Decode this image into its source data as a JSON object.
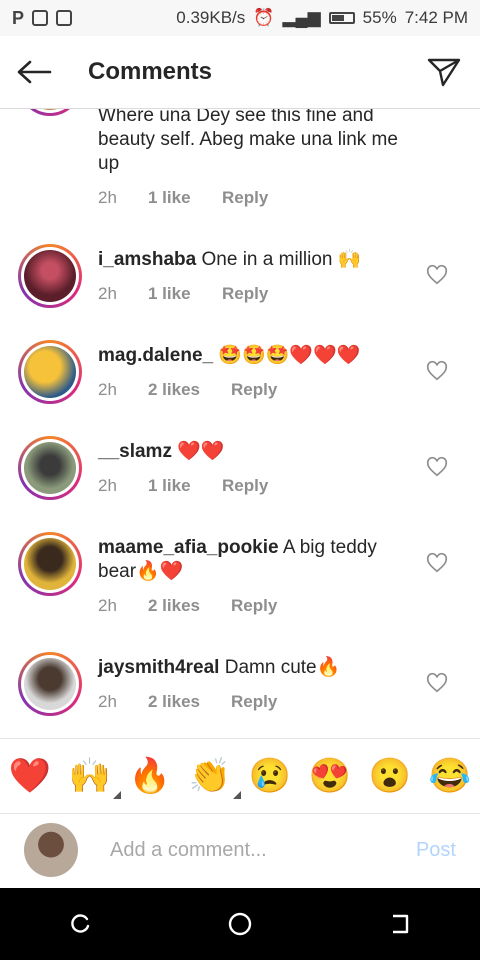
{
  "status_bar": {
    "speed": "0.39KB/s",
    "battery": "55%",
    "time": "7:42 PM"
  },
  "header": {
    "title": "Comments"
  },
  "comments": [
    {
      "user": "",
      "text": "Where una Dey see this fine and beauty self. Abeg make una link me up",
      "time": "2h",
      "likes": "1 like",
      "reply": "Reply"
    },
    {
      "user": "i_amshaba",
      "text": "One in a million 🙌",
      "time": "2h",
      "likes": "1 like",
      "reply": "Reply"
    },
    {
      "user": "mag.dalene_",
      "text": "🤩🤩🤩❤️❤️❤️",
      "time": "2h",
      "likes": "2 likes",
      "reply": "Reply"
    },
    {
      "user": "__slamz",
      "text": "❤️❤️",
      "time": "2h",
      "likes": "1 like",
      "reply": "Reply"
    },
    {
      "user": "maame_afia_pookie",
      "text": "A big teddy bear🔥❤️",
      "time": "2h",
      "likes": "2 likes",
      "reply": "Reply"
    },
    {
      "user": "jaysmith4real",
      "text": "Damn cute🔥",
      "time": "2h",
      "likes": "2 likes",
      "reply": "Reply"
    }
  ],
  "emoji_bar": [
    "❤️",
    "🙌",
    "🔥",
    "👏",
    "😢",
    "😍",
    "😮",
    "😂"
  ],
  "compose": {
    "placeholder": "Add a comment...",
    "post_label": "Post"
  },
  "colors": {
    "accent_post_disabled": "#b3d4fc",
    "muted_text": "#8e8e8e"
  }
}
